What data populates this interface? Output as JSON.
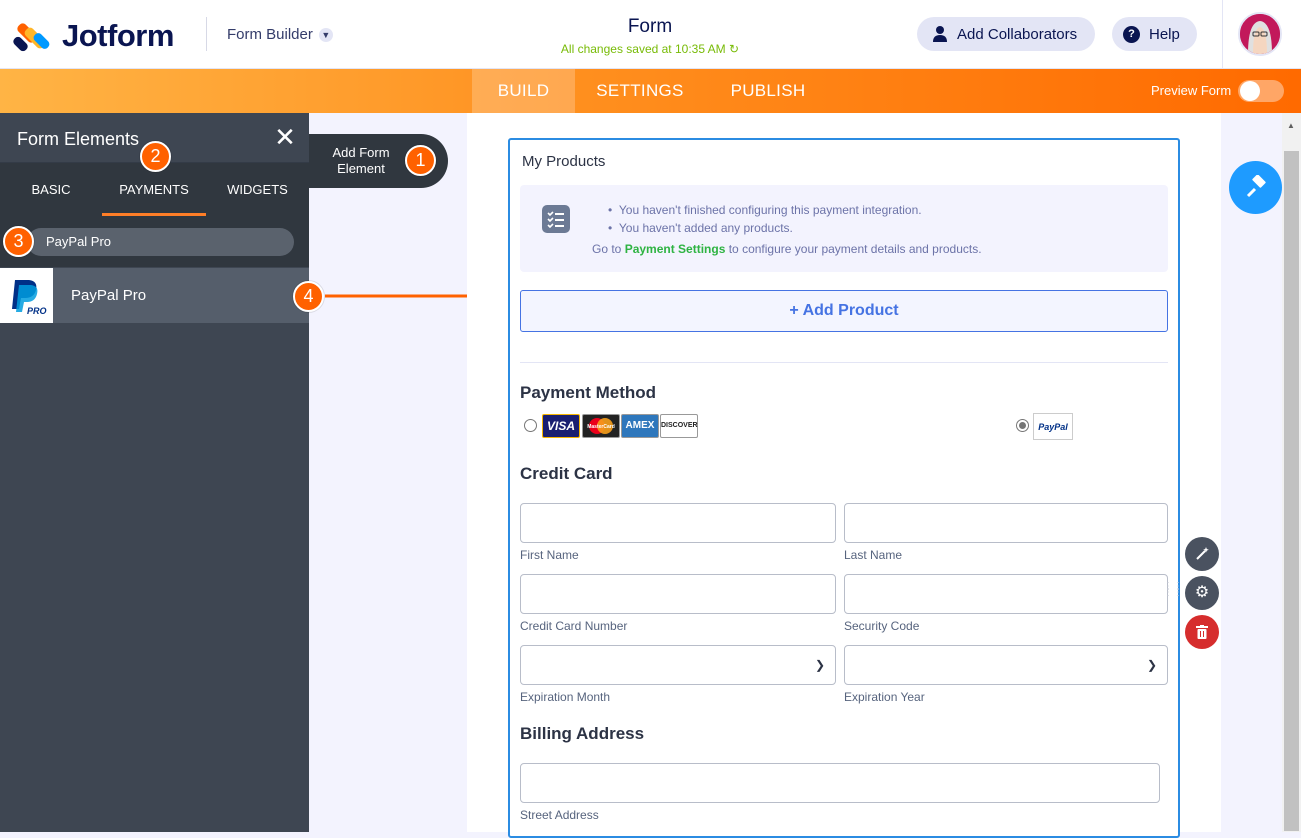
{
  "header": {
    "brand": "Jotform",
    "builder_label": "Form Builder",
    "form_title": "Form",
    "saved_status": "All changes saved at 10:35 AM",
    "collaborators_label": "Add Collaborators",
    "help_label": "Help"
  },
  "nav": {
    "tabs": [
      {
        "label": "BUILD",
        "active": true
      },
      {
        "label": "SETTINGS",
        "active": false
      },
      {
        "label": "PUBLISH",
        "active": false
      }
    ],
    "preview_label": "Preview Form",
    "preview_on": false
  },
  "panel": {
    "title": "Form Elements",
    "tabs": [
      {
        "label": "BASIC",
        "active": false
      },
      {
        "label": "PAYMENTS",
        "active": true
      },
      {
        "label": "WIDGETS",
        "active": false
      }
    ],
    "search_value": "PayPal Pro",
    "result_item": "PayPal Pro",
    "add_element_label": "Add Form Element"
  },
  "badges": [
    "1",
    "2",
    "3",
    "4"
  ],
  "form": {
    "section_label": "My Products",
    "notice": {
      "items": [
        "You haven't finished configuring this payment integration.",
        "You haven't added any products."
      ],
      "line_prefix": "Go to ",
      "link": "Payment Settings",
      "line_suffix": " to configure your payment details and products."
    },
    "add_product": "+ Add Product",
    "payment_method": "Payment Method",
    "cards": [
      "VISA",
      "MasterCard",
      "AMEX",
      "DISCOVER"
    ],
    "paypal_logo": "PayPal",
    "credit_card": "Credit Card",
    "fields": {
      "first_name": "First Name",
      "last_name": "Last Name",
      "cc_number": "Credit Card Number",
      "security_code": "Security Code",
      "exp_month": "Expiration Month",
      "exp_year": "Expiration Year"
    },
    "billing_address": "Billing Address",
    "street_address": "Street Address"
  },
  "colors": {
    "accent": "#ff6100",
    "brand_navy": "#0a1551",
    "link_green": "#2eb342",
    "primary_blue": "#4573e3",
    "danger": "#d62d2d"
  }
}
